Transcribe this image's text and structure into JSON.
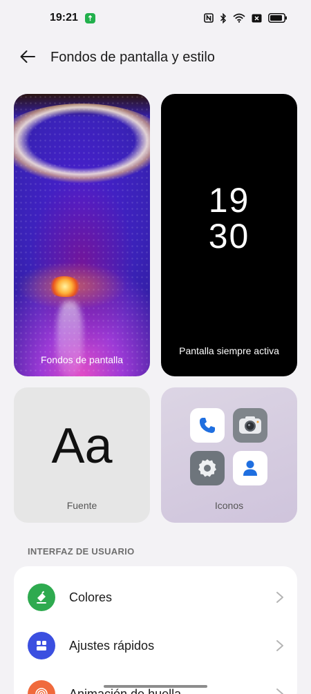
{
  "status_bar": {
    "time": "19:21",
    "icons": [
      "app-notification-icon",
      "nfc-icon",
      "bluetooth-icon",
      "wifi-icon",
      "no-sim-icon",
      "battery-icon"
    ]
  },
  "header": {
    "title": "Fondos de pantalla y estilo",
    "back_icon": "arrow-left-icon"
  },
  "cards": {
    "wallpaper": {
      "label": "Fondos de pantalla"
    },
    "always_on": {
      "clock_hours": "19",
      "clock_minutes": "30",
      "label": "Pantalla siempre activa"
    },
    "font": {
      "sample": "Aa",
      "label": "Fuente"
    },
    "icons": {
      "label": "Iconos",
      "apps": [
        "phone-icon",
        "camera-icon",
        "settings-icon",
        "contacts-icon"
      ]
    }
  },
  "section": {
    "title": "INTERFAZ DE USUARIO"
  },
  "list": {
    "items": [
      {
        "label": "Colores",
        "icon": "paint-bucket-icon",
        "color": "#2eaa4f"
      },
      {
        "label": "Ajustes rápidos",
        "icon": "quick-settings-icon",
        "color": "#3b4fe0"
      },
      {
        "label": "Animación de huella",
        "icon": "fingerprint-icon",
        "color": "#f06a3c"
      }
    ]
  },
  "colors": {
    "background": "#f3f2f5",
    "card_surface": "#ffffff"
  }
}
